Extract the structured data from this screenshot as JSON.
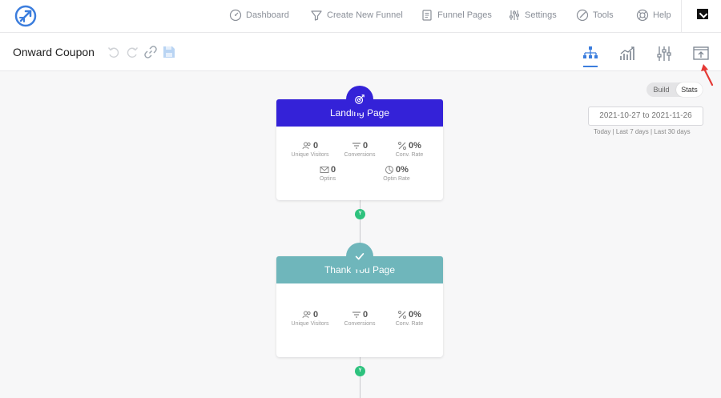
{
  "nav": {
    "items": [
      {
        "label": "Dashboard",
        "icon": "gauge-icon"
      },
      {
        "label": "Create New Funnel",
        "icon": "funnel-icon"
      },
      {
        "label": "Funnel Pages",
        "icon": "document-icon"
      },
      {
        "label": "Settings",
        "icon": "sliders-icon"
      },
      {
        "label": "Tools",
        "icon": "target-icon"
      },
      {
        "label": "Help",
        "icon": "lifebuoy-icon"
      }
    ]
  },
  "toolbar": {
    "funnel_title": "Onward Coupon",
    "tools": [
      "undo-icon",
      "redo-icon",
      "link-icon",
      "save-icon"
    ],
    "views": [
      "flow-view-icon",
      "analytics-view-icon",
      "settings-view-icon",
      "export-view-icon"
    ],
    "active_view": "flow-view-icon"
  },
  "stats_panel": {
    "toggle": {
      "build": "Build",
      "stats": "Stats",
      "selected": "Stats"
    },
    "date_range": "2021-10-27 to 2021-11-26",
    "quick_ranges": "Today | Last 7 days | Last 30 days"
  },
  "connectors": {
    "badge_text": "Y"
  },
  "cards": {
    "landing": {
      "title": "Landing Page",
      "color": "#3422d8",
      "icon": "target-arrow-icon",
      "stats": {
        "unique_visitors": {
          "value": "0",
          "label": "Unique Visitors"
        },
        "conversions": {
          "value": "0",
          "label": "Conversions"
        },
        "conv_rate": {
          "value": "0%",
          "label": "Conv. Rate"
        },
        "optins": {
          "value": "0",
          "label": "Optins"
        },
        "optin_rate": {
          "value": "0%",
          "label": "Optin Rate"
        }
      }
    },
    "thankyou": {
      "title": "Thank You Page",
      "color": "#6fb6bb",
      "icon": "checkmark-icon",
      "stats": {
        "unique_visitors": {
          "value": "0",
          "label": "Unique Visitors"
        },
        "conversions": {
          "value": "0",
          "label": "Conversions"
        },
        "conv_rate": {
          "value": "0%",
          "label": "Conv. Rate"
        }
      }
    }
  },
  "colors": {
    "accent": "#3b7ddd",
    "yes_badge": "#2ec27e",
    "annotation": "#e53935"
  }
}
